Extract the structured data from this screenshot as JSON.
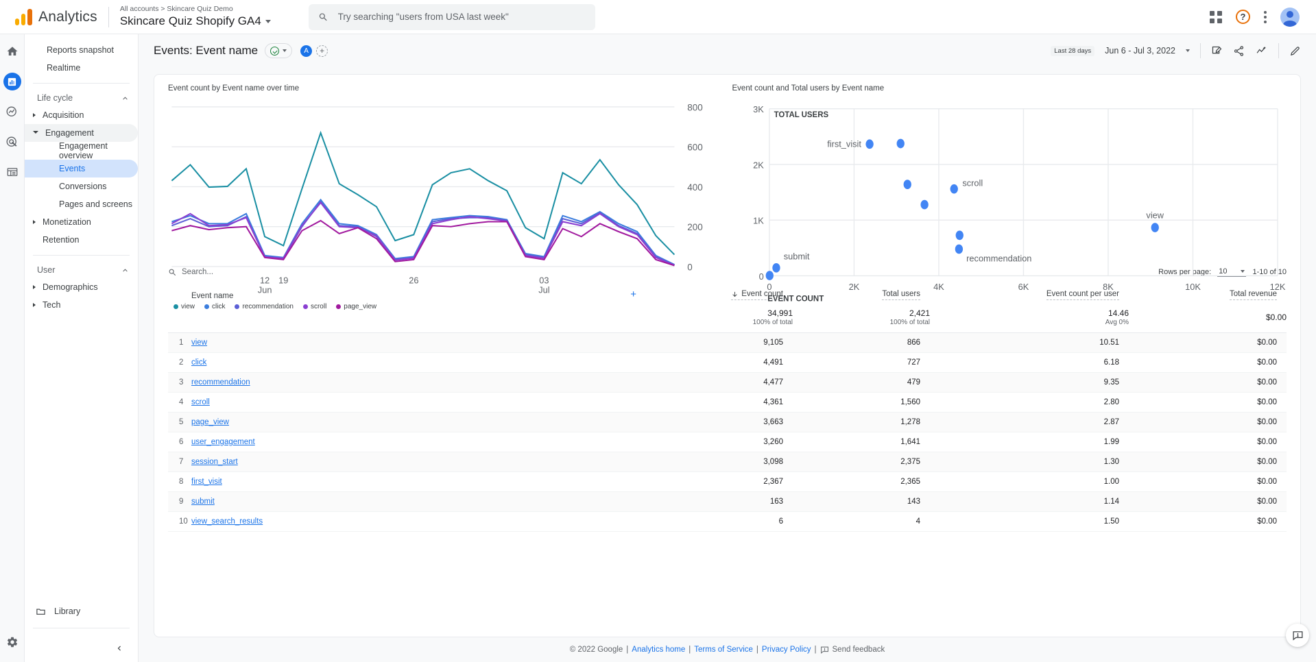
{
  "topbar": {
    "brand": "Analytics",
    "breadcrumb": "All accounts > Skincare Quiz Demo",
    "property": "Skincare Quiz Shopify GA4",
    "search_placeholder": "Try searching \"users from USA last week\"",
    "search_value": ""
  },
  "rail": {
    "items": [
      {
        "name": "home-icon",
        "label": "Home"
      },
      {
        "name": "reports-icon",
        "label": "Reports"
      },
      {
        "name": "explore-icon",
        "label": "Explore"
      },
      {
        "name": "advertising-icon",
        "label": "Advertising"
      },
      {
        "name": "library-icon",
        "label": "Library"
      }
    ],
    "settings_label": "Admin"
  },
  "sidebar": {
    "top_items": [
      "Reports snapshot",
      "Realtime"
    ],
    "section_lifecycle": "Life cycle",
    "acquisition": "Acquisition",
    "engagement": "Engagement",
    "engagement_children": [
      "Engagement overview",
      "Events",
      "Conversions",
      "Pages and screens"
    ],
    "selected_child": "Events",
    "monetization": "Monetization",
    "retention": "Retention",
    "section_user": "User",
    "demographics": "Demographics",
    "tech": "Tech",
    "library": "Library"
  },
  "titlebar": {
    "report_title": "Events: Event name",
    "avatar_initial": "A",
    "add_label": "+",
    "range_chip": "Last 28 days",
    "range_text": "Jun 6 - Jul 3, 2022"
  },
  "table": {
    "search_placeholder": "Search...",
    "search_value": "",
    "rows_per_page_label": "Rows per page:",
    "rows_per_page_value": "10",
    "pagination": "1-10 of 10",
    "columns": [
      "Event name",
      "Event count",
      "Total users",
      "Event count per user",
      "Total revenue"
    ],
    "sorted_column": "Event count",
    "totals": [
      {
        "value": "34,991",
        "sub": "100% of total"
      },
      {
        "value": "2,421",
        "sub": "100% of total"
      },
      {
        "value": "14.46",
        "sub": "Avg 0%"
      },
      {
        "value": "$0.00",
        "sub": ""
      }
    ],
    "rows": [
      {
        "idx": "1",
        "name": "view",
        "event_count": "9,105",
        "total_users": "866",
        "per_user": "10.51",
        "revenue": "$0.00"
      },
      {
        "idx": "2",
        "name": "click",
        "event_count": "4,491",
        "total_users": "727",
        "per_user": "6.18",
        "revenue": "$0.00"
      },
      {
        "idx": "3",
        "name": "recommendation",
        "event_count": "4,477",
        "total_users": "479",
        "per_user": "9.35",
        "revenue": "$0.00"
      },
      {
        "idx": "4",
        "name": "scroll",
        "event_count": "4,361",
        "total_users": "1,560",
        "per_user": "2.80",
        "revenue": "$0.00"
      },
      {
        "idx": "5",
        "name": "page_view",
        "event_count": "3,663",
        "total_users": "1,278",
        "per_user": "2.87",
        "revenue": "$0.00"
      },
      {
        "idx": "6",
        "name": "user_engagement",
        "event_count": "3,260",
        "total_users": "1,641",
        "per_user": "1.99",
        "revenue": "$0.00"
      },
      {
        "idx": "7",
        "name": "session_start",
        "event_count": "3,098",
        "total_users": "2,375",
        "per_user": "1.30",
        "revenue": "$0.00"
      },
      {
        "idx": "8",
        "name": "first_visit",
        "event_count": "2,367",
        "total_users": "2,365",
        "per_user": "1.00",
        "revenue": "$0.00"
      },
      {
        "idx": "9",
        "name": "submit",
        "event_count": "163",
        "total_users": "143",
        "per_user": "1.14",
        "revenue": "$0.00"
      },
      {
        "idx": "10",
        "name": "view_search_results",
        "event_count": "6",
        "total_users": "4",
        "per_user": "1.50",
        "revenue": "$0.00"
      }
    ]
  },
  "footer": {
    "copyright": "© 2022 Google",
    "links": [
      "Analytics home",
      "Terms of Service",
      "Privacy Policy"
    ],
    "feedback": "Send feedback"
  },
  "colors": {
    "accent": "#1a73e8",
    "view": "#1a8fa3",
    "click": "#3b7ddd",
    "recommendation": "#5b5fd6",
    "scroll": "#8a3fd1",
    "page_view": "#a1199e",
    "scatter_point": "#4285f4"
  },
  "chart_data": [
    {
      "type": "line",
      "title": "Event count by Event name over time",
      "xlabel": "",
      "ylabel": "",
      "ylim": [
        0,
        800
      ],
      "yticks": [
        0,
        200,
        400,
        600,
        800
      ],
      "xticks": [
        "12\nJun",
        "19",
        "26",
        "03\nJul"
      ],
      "xtick_positions": [
        5,
        12,
        19,
        26
      ],
      "grid": true,
      "legend_position": "bottom",
      "x": [
        6,
        7,
        8,
        9,
        10,
        11,
        12,
        13,
        14,
        15,
        16,
        17,
        18,
        19,
        20,
        21,
        22,
        23,
        24,
        25,
        26,
        27,
        28,
        29,
        30,
        31,
        32,
        33
      ],
      "series": [
        {
          "name": "view",
          "color": "#1a8fa3",
          "values": [
            430,
            510,
            398,
            402,
            490,
            150,
            105,
            390,
            670,
            415,
            360,
            300,
            130,
            160,
            410,
            470,
            490,
            430,
            380,
            195,
            140,
            470,
            415,
            535,
            410,
            310,
            155,
            60
          ]
        },
        {
          "name": "click",
          "color": "#3b7ddd",
          "values": [
            225,
            255,
            215,
            215,
            265,
            55,
            45,
            215,
            335,
            215,
            205,
            160,
            40,
            50,
            235,
            245,
            255,
            250,
            235,
            65,
            50,
            255,
            225,
            275,
            215,
            175,
            55,
            10
          ]
        },
        {
          "name": "recommendation",
          "color": "#5b5fd6",
          "values": [
            205,
            240,
            200,
            205,
            250,
            50,
            40,
            200,
            325,
            205,
            200,
            150,
            35,
            45,
            225,
            240,
            245,
            245,
            230,
            60,
            45,
            240,
            215,
            270,
            205,
            165,
            50,
            8
          ]
        },
        {
          "name": "scroll",
          "color": "#8a3fd1",
          "values": [
            215,
            265,
            205,
            210,
            245,
            48,
            42,
            205,
            320,
            200,
            195,
            155,
            32,
            42,
            215,
            235,
            250,
            240,
            228,
            55,
            42,
            225,
            205,
            265,
            200,
            160,
            45,
            6
          ]
        },
        {
          "name": "page_view",
          "color": "#a1199e",
          "values": [
            180,
            205,
            185,
            195,
            200,
            45,
            35,
            180,
            230,
            165,
            195,
            140,
            25,
            35,
            205,
            200,
            215,
            225,
            225,
            50,
            35,
            190,
            150,
            215,
            175,
            140,
            35,
            5
          ]
        }
      ]
    },
    {
      "type": "scatter",
      "title": "Event count and Total users by Event name",
      "xlabel": "EVENT COUNT",
      "ylabel": "TOTAL USERS",
      "xlim": [
        0,
        12000
      ],
      "ylim": [
        0,
        3000
      ],
      "xticks": [
        "0",
        "2K",
        "4K",
        "6K",
        "8K",
        "10K",
        "12K"
      ],
      "yticks": [
        "0",
        "1K",
        "2K",
        "3K"
      ],
      "grid": true,
      "point_color": "#4285f4",
      "points": [
        {
          "label": "view",
          "x": 9105,
          "y": 866,
          "label_pos": "above"
        },
        {
          "label": "click",
          "x": 4491,
          "y": 727,
          "label_pos": "none"
        },
        {
          "label": "recommendation",
          "x": 4477,
          "y": 479,
          "label_pos": "below-right"
        },
        {
          "label": "scroll",
          "x": 4361,
          "y": 1560,
          "label_pos": "right"
        },
        {
          "label": "page_view",
          "x": 3663,
          "y": 1278,
          "label_pos": "none"
        },
        {
          "label": "user_engagement",
          "x": 3260,
          "y": 1641,
          "label_pos": "none"
        },
        {
          "label": "session_start",
          "x": 3098,
          "y": 2375,
          "label_pos": "none"
        },
        {
          "label": "first_visit",
          "x": 2367,
          "y": 2365,
          "label_pos": "left"
        },
        {
          "label": "submit",
          "x": 163,
          "y": 143,
          "label_pos": "above-right"
        },
        {
          "label": "view_search_results",
          "x": 6,
          "y": 4,
          "label_pos": "none"
        }
      ]
    }
  ]
}
